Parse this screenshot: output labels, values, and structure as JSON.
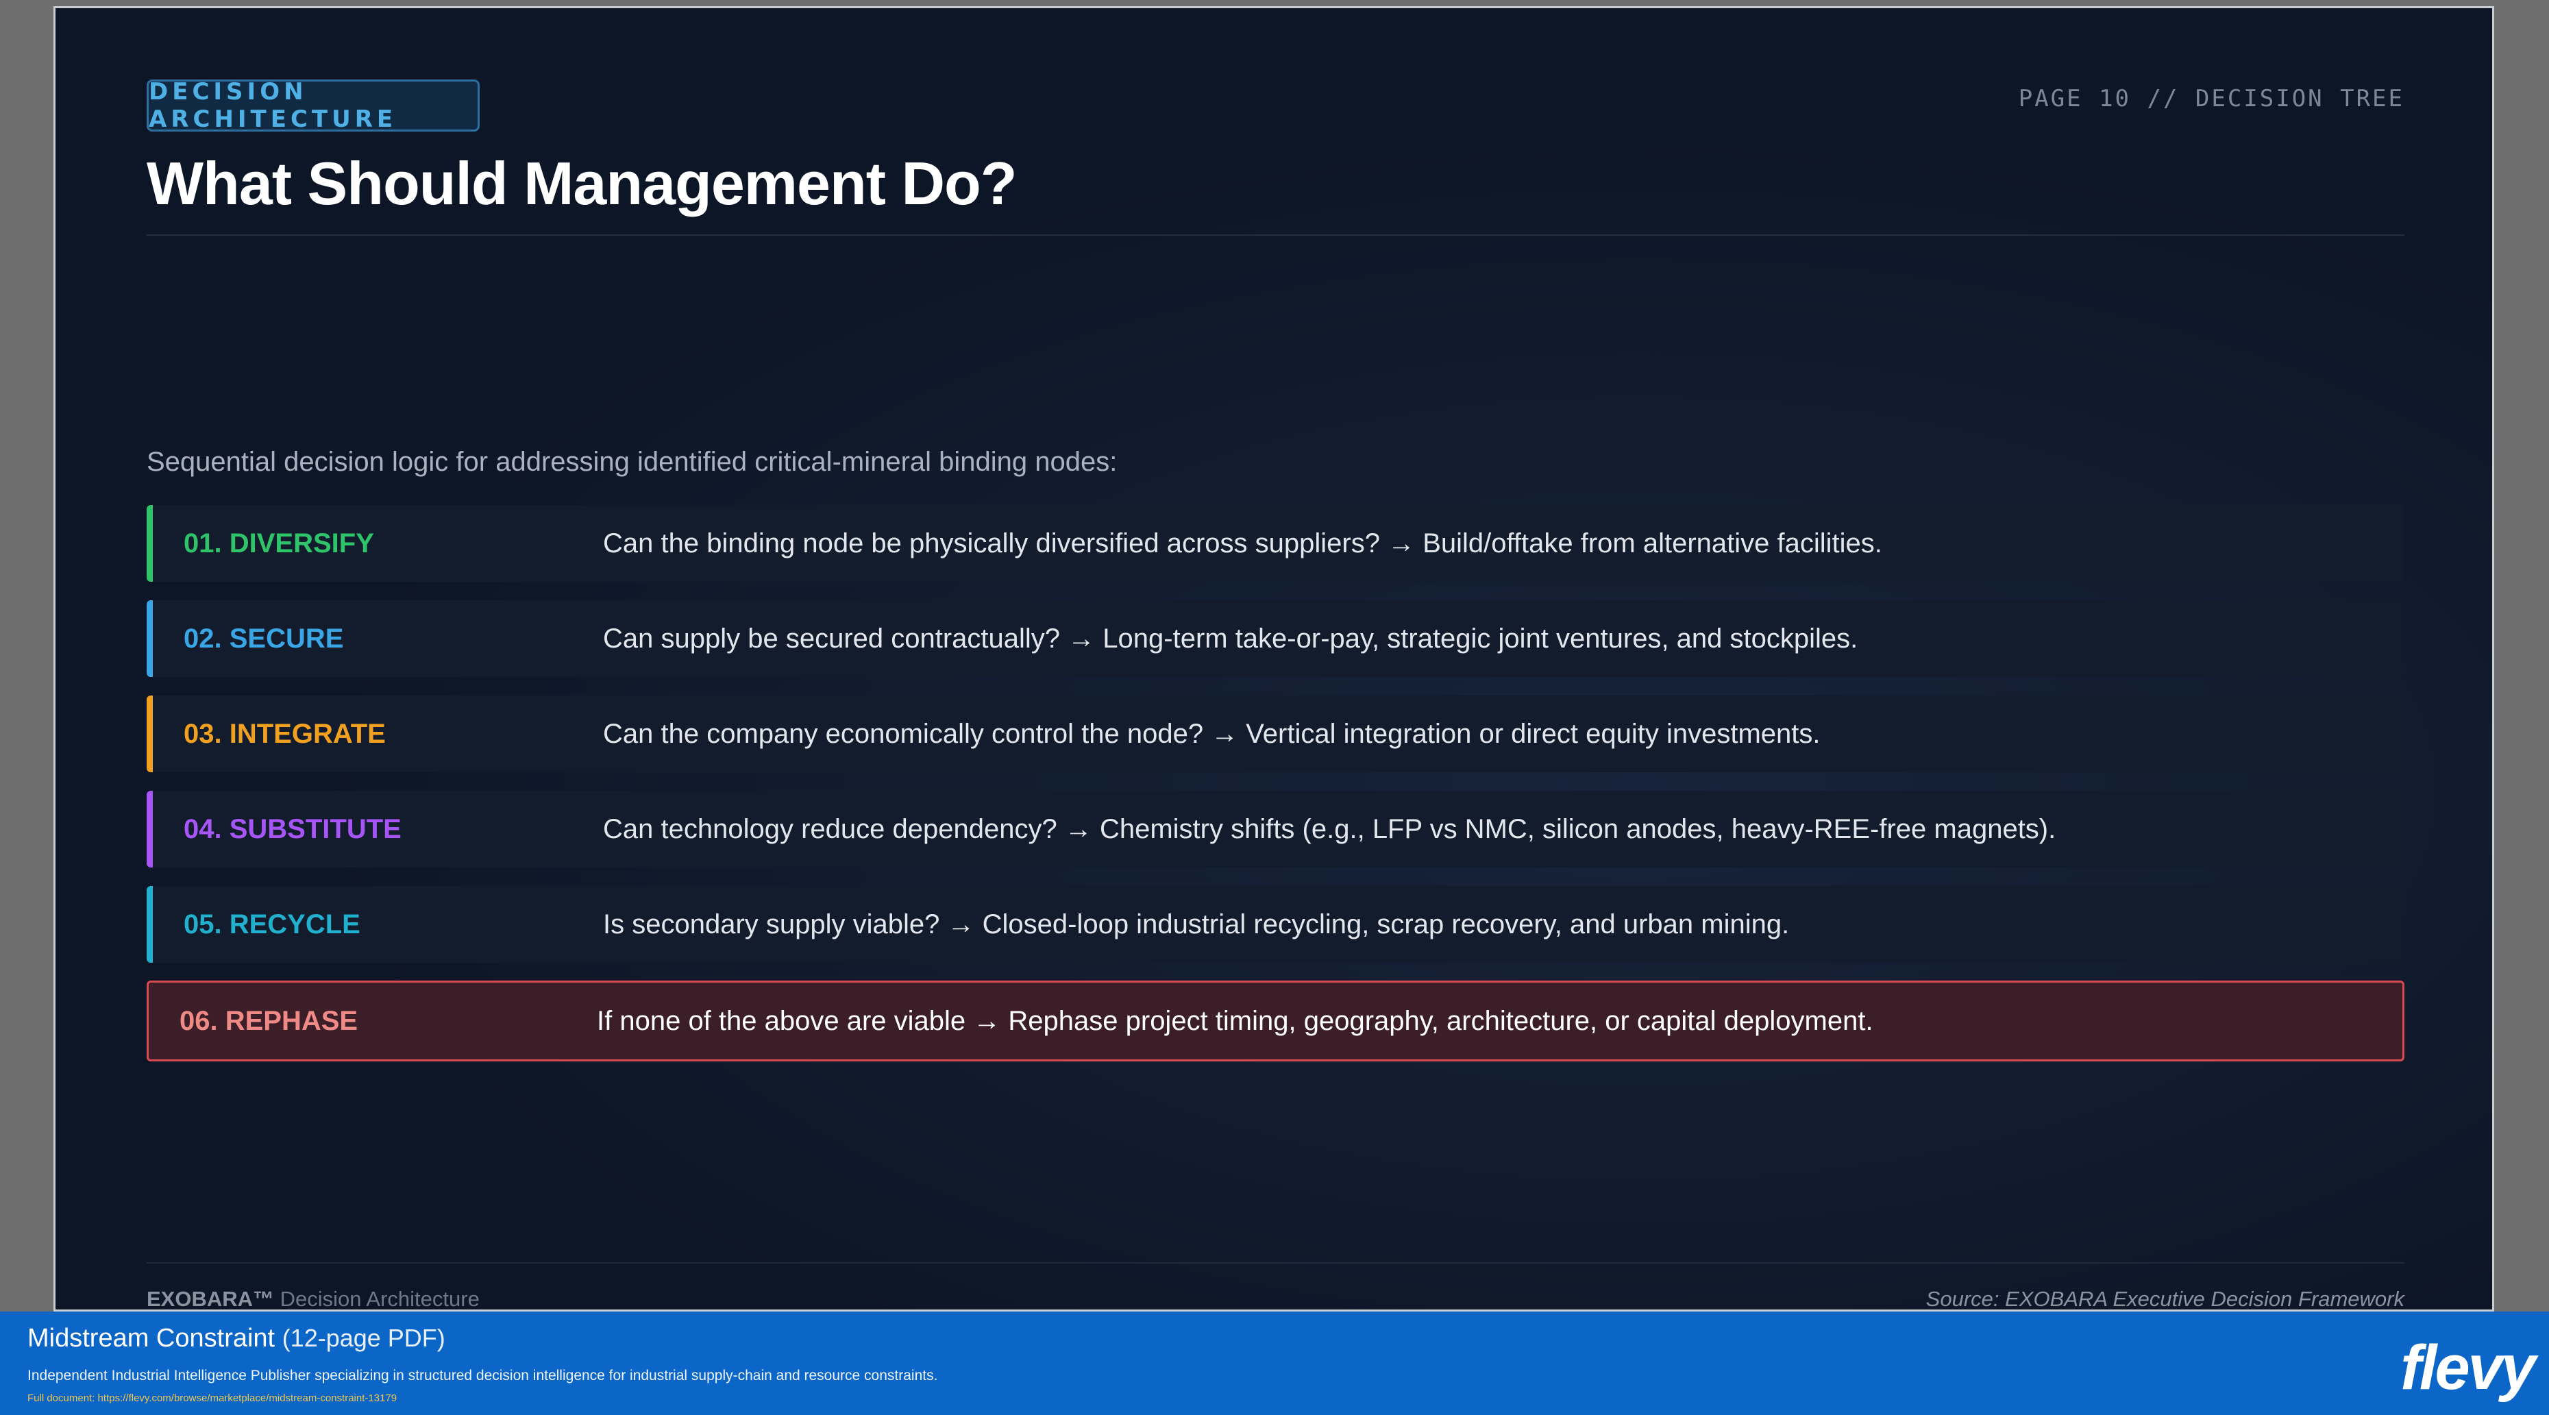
{
  "header": {
    "tag": "DECISION ARCHITECTURE",
    "page_label": "PAGE 10 // DECISION TREE",
    "title": "What Should Management Do?"
  },
  "intro": "Sequential decision logic for addressing identified critical-mineral binding nodes:",
  "steps": [
    {
      "label": "01. DIVERSIFY",
      "text": "Can the binding node be physically diversified across suppliers? → Build/offtake from alternative facilities.",
      "color": "#2fc46a"
    },
    {
      "label": "02. SECURE",
      "text": "Can supply be secured contractually? → Long-term take-or-pay, strategic joint ventures, and stockpiles.",
      "color": "#3aa6e6"
    },
    {
      "label": "03. INTEGRATE",
      "text": "Can the company economically control the node? → Vertical integration or direct equity investments.",
      "color": "#f2a020"
    },
    {
      "label": "04. SUBSTITUTE",
      "text": "Can technology reduce dependency? → Chemistry shifts (e.g., LFP vs NMC, silicon anodes, heavy-REE-free magnets).",
      "color": "#a855f7"
    },
    {
      "label": "05. RECYCLE",
      "text": "Is secondary supply viable? → Closed-loop industrial recycling, scrap recovery, and urban mining.",
      "color": "#22b0cf"
    },
    {
      "label": "06. REPHASE",
      "text": "If none of the above are viable → Rephase project timing, geography, architecture, or capital deployment.",
      "color": "#f08a86"
    }
  ],
  "footer": {
    "brand": "EXOBARA™",
    "brand_suffix": "Decision Architecture",
    "source": "Source: EXOBARA Executive Decision Framework"
  },
  "banner": {
    "title": "Midstream Constraint",
    "pages": "(12-page PDF)",
    "subtitle": "Independent Industrial Intelligence Publisher specializing in structured decision intelligence for industrial supply-chain and resource constraints.",
    "link": "Full document: https://flevy.com/browse/marketplace/midstream-constraint-13179",
    "logo": "flevy"
  }
}
